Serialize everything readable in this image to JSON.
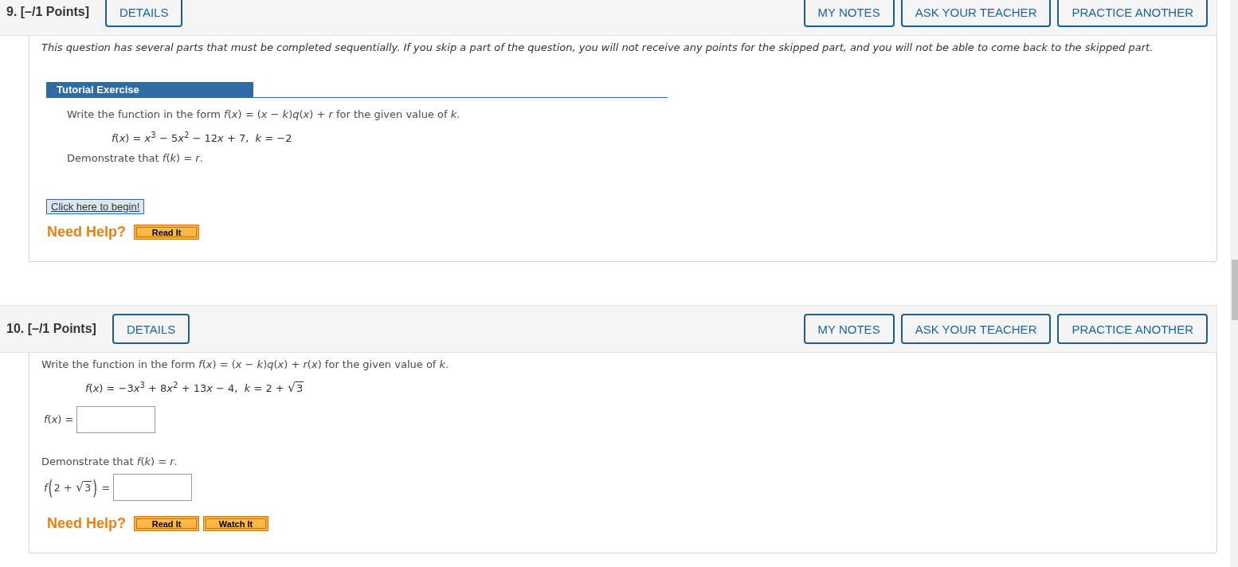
{
  "questions": [
    {
      "header": {
        "title": "9. [–/1 Points]",
        "details": "DETAILS",
        "actions": [
          "MY NOTES",
          "ASK YOUR TEACHER",
          "PRACTICE ANOTHER"
        ]
      },
      "body": [
        {
          "kind": "notice",
          "text": "This question has several parts that must be completed sequentially. If you skip a part of the question, you will not receive any points for the skipped part, and you will not be able to come back to the skipped part."
        },
        {
          "kind": "tutorial",
          "title": "Tutorial Exercise",
          "lines": [
            {
              "kind": "prompt",
              "text": "Write the function in the form *f*(*x*) = (*x* − *k*)*q*(*x*) + *r* for the given value of *k*."
            },
            {
              "kind": "formula",
              "parts": [
                {
                  "kind": "text",
                  "text": "*f*(*x*) = *x*$^{3}$ − 5"
                },
                {
                  "kind": "text",
                  "text": "*x*$^{2}$ − 12"
                },
                {
                  "kind": "text",
                  "text": "*x* + 7,  *k* = −2"
                }
              ]
            },
            {
              "kind": "prompt",
              "text": "Demonstrate that *f*(*k*) = *r*."
            }
          ]
        },
        {
          "kind": "begin",
          "label": "Click here to begin!"
        },
        {
          "kind": "help",
          "label": "Need Help?",
          "buttons": [
            "Read It"
          ]
        }
      ]
    },
    {
      "header": {
        "title": "10. [–/1 Points]",
        "details": "DETAILS",
        "actions": [
          "MY NOTES",
          "ASK YOUR TEACHER",
          "PRACTICE ANOTHER"
        ]
      },
      "body": [
        {
          "kind": "prompt",
          "text": "Write the function in the form *f*(*x*) = (*x* − *k*)*q*(*x*) + *r*(*x*) for the given value of *k*."
        },
        {
          "kind": "formula",
          "parts": [
            {
              "kind": "text",
              "text": "*f*(*x*) = −3"
            },
            {
              "kind": "text",
              "text": "*x*$^{3}$ + 8"
            },
            {
              "kind": "text",
              "text": "*x*$^{2}$ + 13"
            },
            {
              "kind": "text",
              "text": "*x* − 4,  *k* = 2 + "
            },
            {
              "kind": "radical",
              "text": "√"
            },
            {
              "kind": "radicand",
              "text": "3"
            }
          ]
        },
        {
          "kind": "answer",
          "label": [
            {
              "kind": "text",
              "text": "*f*(*x*) ="
            }
          ]
        },
        {
          "kind": "prompt",
          "text": "Demonstrate that *f*(*k*) = *r*."
        },
        {
          "kind": "answer",
          "label": [
            {
              "kind": "text",
              "text": "*f*"
            },
            {
              "kind": "paren",
              "text": "("
            },
            {
              "kind": "text",
              "text": "2 + "
            },
            {
              "kind": "radical",
              "text": "√"
            },
            {
              "kind": "radicand",
              "text": "3"
            },
            {
              "kind": "paren",
              "text": ")"
            },
            {
              "kind": "text",
              "text": " ="
            }
          ]
        },
        {
          "kind": "help",
          "label": "Need Help?",
          "buttons": [
            "Read It",
            "Watch It"
          ]
        }
      ]
    }
  ]
}
